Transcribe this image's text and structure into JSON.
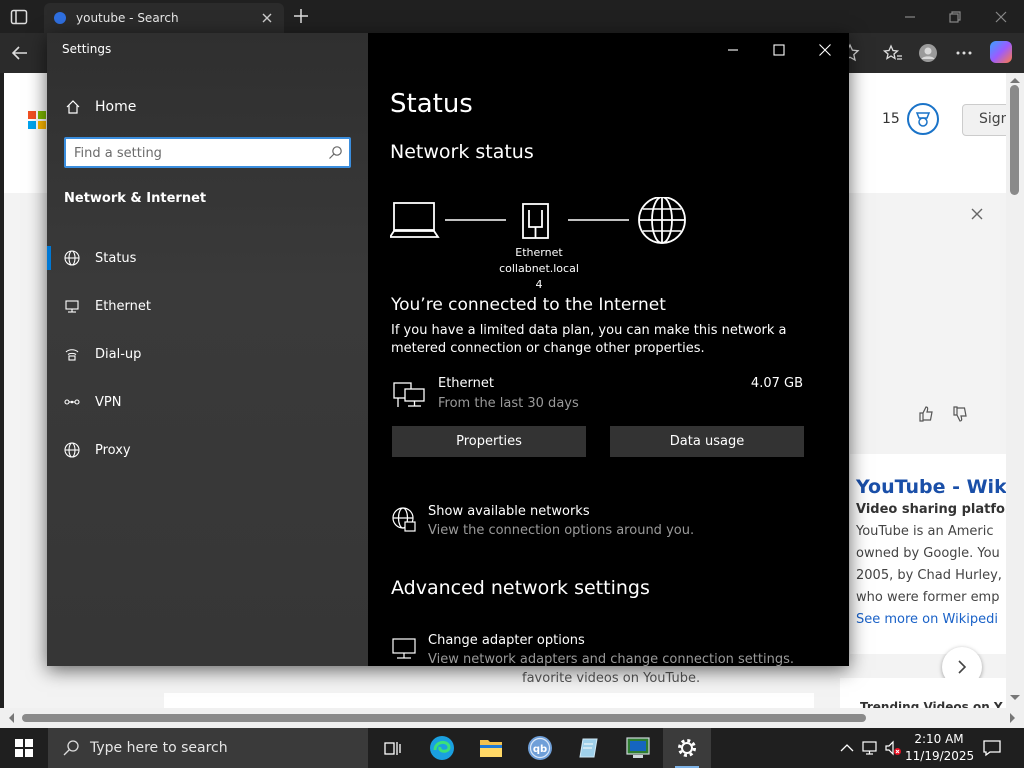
{
  "browser": {
    "tab_title": "youtube - Search",
    "rewards_count": "15",
    "signin_label": "Sign",
    "favorite_videos_text": "favorite videos on YouTube.",
    "wiki": {
      "title": "YouTube - Wiki",
      "subtitle": "Video sharing platfor",
      "lines": [
        "YouTube is an Americ",
        "owned by Google. You",
        "2005, by Chad Hurley,",
        "who were former emp"
      ],
      "more": "See more on Wikipedi"
    },
    "trending_text": "Trending Videos on Y"
  },
  "settings": {
    "app_title": "Settings",
    "nav": {
      "home_label": "Home",
      "search_placeholder": "Find a setting",
      "section_title": "Network & Internet",
      "items": [
        {
          "label": "Status",
          "icon": "globe-icon",
          "selected": true
        },
        {
          "label": "Ethernet",
          "icon": "ethernet-icon",
          "selected": false
        },
        {
          "label": "Dial-up",
          "icon": "dialup-icon",
          "selected": false
        },
        {
          "label": "VPN",
          "icon": "vpn-icon",
          "selected": false
        },
        {
          "label": "Proxy",
          "icon": "globe-icon",
          "selected": false
        }
      ]
    },
    "content": {
      "page_title": "Status",
      "network_status_heading": "Network status",
      "adapter_name": "Ethernet",
      "network_name": "collabnet.local 4",
      "connected_title": "You’re connected to the Internet",
      "connected_desc": "If you have a limited data plan, you can make this network a metered connection or change other properties.",
      "usage": {
        "name": "Ethernet",
        "period": "From the last 30 days",
        "amount": "4.07 GB"
      },
      "properties_label": "Properties",
      "data_usage_label": "Data usage",
      "show_networks": {
        "title": "Show available networks",
        "subtitle": "View the connection options around you."
      },
      "advanced_heading": "Advanced network settings",
      "change_adapter": {
        "title": "Change adapter options",
        "subtitle": "View network adapters and change connection settings."
      }
    }
  },
  "taskbar": {
    "search_placeholder": "Type here to search",
    "apps": [
      "task-view",
      "edge",
      "file-explorer",
      "qbittorrent",
      "notepad",
      "remote-desktop",
      "settings"
    ],
    "time": "2:10 AM",
    "date": "11/19/2025"
  },
  "colors": {
    "accent": "#0078d4",
    "settings_bg": "#000000",
    "nav_bg": "#353535",
    "button_bg": "#333333"
  }
}
